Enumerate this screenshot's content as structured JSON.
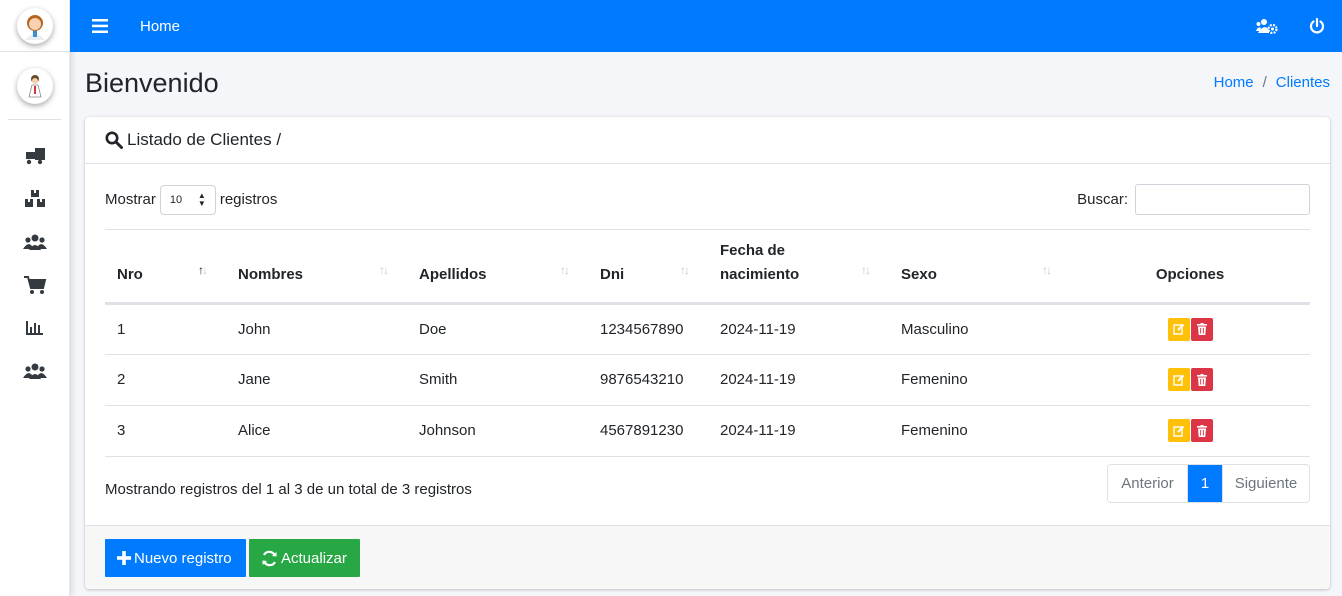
{
  "navbar": {
    "home": "Home"
  },
  "header": {
    "title": "Bienvenido",
    "breadcrumb": [
      "Home",
      "Clientes"
    ]
  },
  "card": {
    "title": "Listado de Clientes /"
  },
  "controls": {
    "show_prefix": "Mostrar",
    "page_size": "10",
    "show_suffix": "registros",
    "search_label": "Buscar:",
    "search_value": ""
  },
  "table": {
    "columns": [
      "Nro",
      "Nombres",
      "Apellidos",
      "Dni",
      "Fecha de nacimiento",
      "Sexo",
      "Opciones"
    ],
    "rows": [
      [
        "1",
        "John",
        "Doe",
        "1234567890",
        "2024-11-19",
        "Masculino"
      ],
      [
        "2",
        "Jane",
        "Smith",
        "9876543210",
        "2024-11-19",
        "Femenino"
      ],
      [
        "3",
        "Alice",
        "Johnson",
        "4567891230",
        "2024-11-19",
        "Femenino"
      ]
    ]
  },
  "footer": {
    "info": "Mostrando registros del 1 al 3 de un total de 3 registros",
    "pager": {
      "prev": "Anterior",
      "current": "1",
      "next": "Siguiente"
    }
  },
  "buttons": {
    "new": "Nuevo registro",
    "refresh": "Actualizar"
  },
  "colors": {
    "primary": "#007bff",
    "success": "#28a745",
    "warning": "#ffc107",
    "danger": "#dc3545"
  },
  "icons": [
    "menu-icon",
    "users-cog-icon",
    "power-icon",
    "search-icon",
    "truck-loading-icon",
    "boxes-icon",
    "users-icon",
    "cart-icon",
    "bar-chart-icon",
    "edit-icon",
    "trash-icon",
    "plus-icon",
    "sync-icon"
  ]
}
